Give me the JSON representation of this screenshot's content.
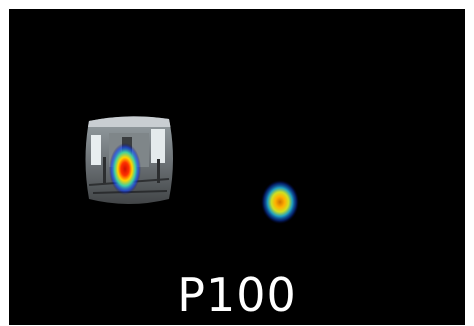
{
  "panel": {
    "caption": "P100"
  },
  "colors": {
    "background": "#000000",
    "caption": "#ffffff",
    "heat_high": "#ff2000",
    "heat_mid": "#ffd000",
    "heat_low": "#20c0ff"
  },
  "scene": {
    "fisheye_view": "indoor-room-fisheye",
    "heatmap_blobs": 2
  }
}
